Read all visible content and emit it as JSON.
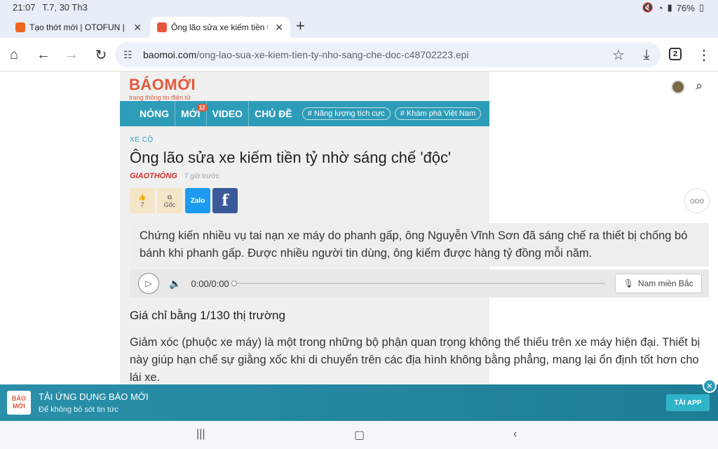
{
  "status_bar": {
    "time": "21:07",
    "date": "T.7, 30 Th3",
    "battery": "76%",
    "icons": [
      "mute-icon",
      "wifi-icon",
      "signal-icon",
      "battery-icon"
    ]
  },
  "tabs": [
    {
      "title": "Tạo thớt mới | OTOFUN | CỘNG Đ",
      "favicon_color": "#f0651f"
    },
    {
      "title": "Ông lão sửa xe kiếm tiền tỷ nhờ sáng chế",
      "favicon_color": "#e3583b",
      "active": true
    }
  ],
  "toolbar": {
    "url_host": "baomoi.com",
    "url_path": "/ong-lao-sua-xe-kiem-tien-ty-nho-sang-che-doc-c48702223.epi",
    "tab_count": "2"
  },
  "site": {
    "logo": "BÁOMỚI",
    "tagline": "trang thông tin điện tử",
    "nav": [
      {
        "label": "NÓNG"
      },
      {
        "label": "MỚI",
        "badge": "12"
      },
      {
        "label": "VIDEO"
      },
      {
        "label": "CHỦ ĐỀ"
      }
    ],
    "pills": [
      "# Năng lượng tích cực",
      "# Khám phá Việt Nam"
    ]
  },
  "article": {
    "category": "XE CỘ",
    "title": "Ông lão sửa xe kiếm tiền tỷ nhờ sáng chế 'độc'",
    "publisher": "GIAOTHÔNG",
    "time_ago": "7 giờ trước",
    "like_count": "7",
    "origin_label": "Gốc",
    "zalo_label": "Zalo",
    "facebook_label": "f",
    "sapo": "Chứng kiến nhiều vụ tai nạn xe máy do phanh gấp, ông Nguyễn Vĩnh Sơn đã sáng chế ra thiết bị chống bó bánh khi phanh gấp. Được nhiều người tin dùng, ông kiếm được hàng tỷ đồng mỗi năm.",
    "audio_time": "0:00/0:00",
    "audio_progress": 0,
    "voice_label": "Nam miền Bắc",
    "subheading": "Giá chỉ bằng 1/130 thị trường",
    "paragraph": "Giảm xóc (phuộc xe máy) là một trong những bộ phận quan trọng không thể thiếu trên xe máy hiện đại. Thiết bị này giúp hạn chế sự giằng xốc khi di chuyển trên các địa hình không bằng phẳng, mang lại ổn định tốt hơn cho lái xe."
  },
  "banner": {
    "logo_line1": "BÁO",
    "logo_line2": "MỚI",
    "title": "TẢI ỨNG DỤNG BÁO MỚI",
    "subtitle": "Để không bỏ sót tin tức",
    "cta": "TẢI APP"
  }
}
